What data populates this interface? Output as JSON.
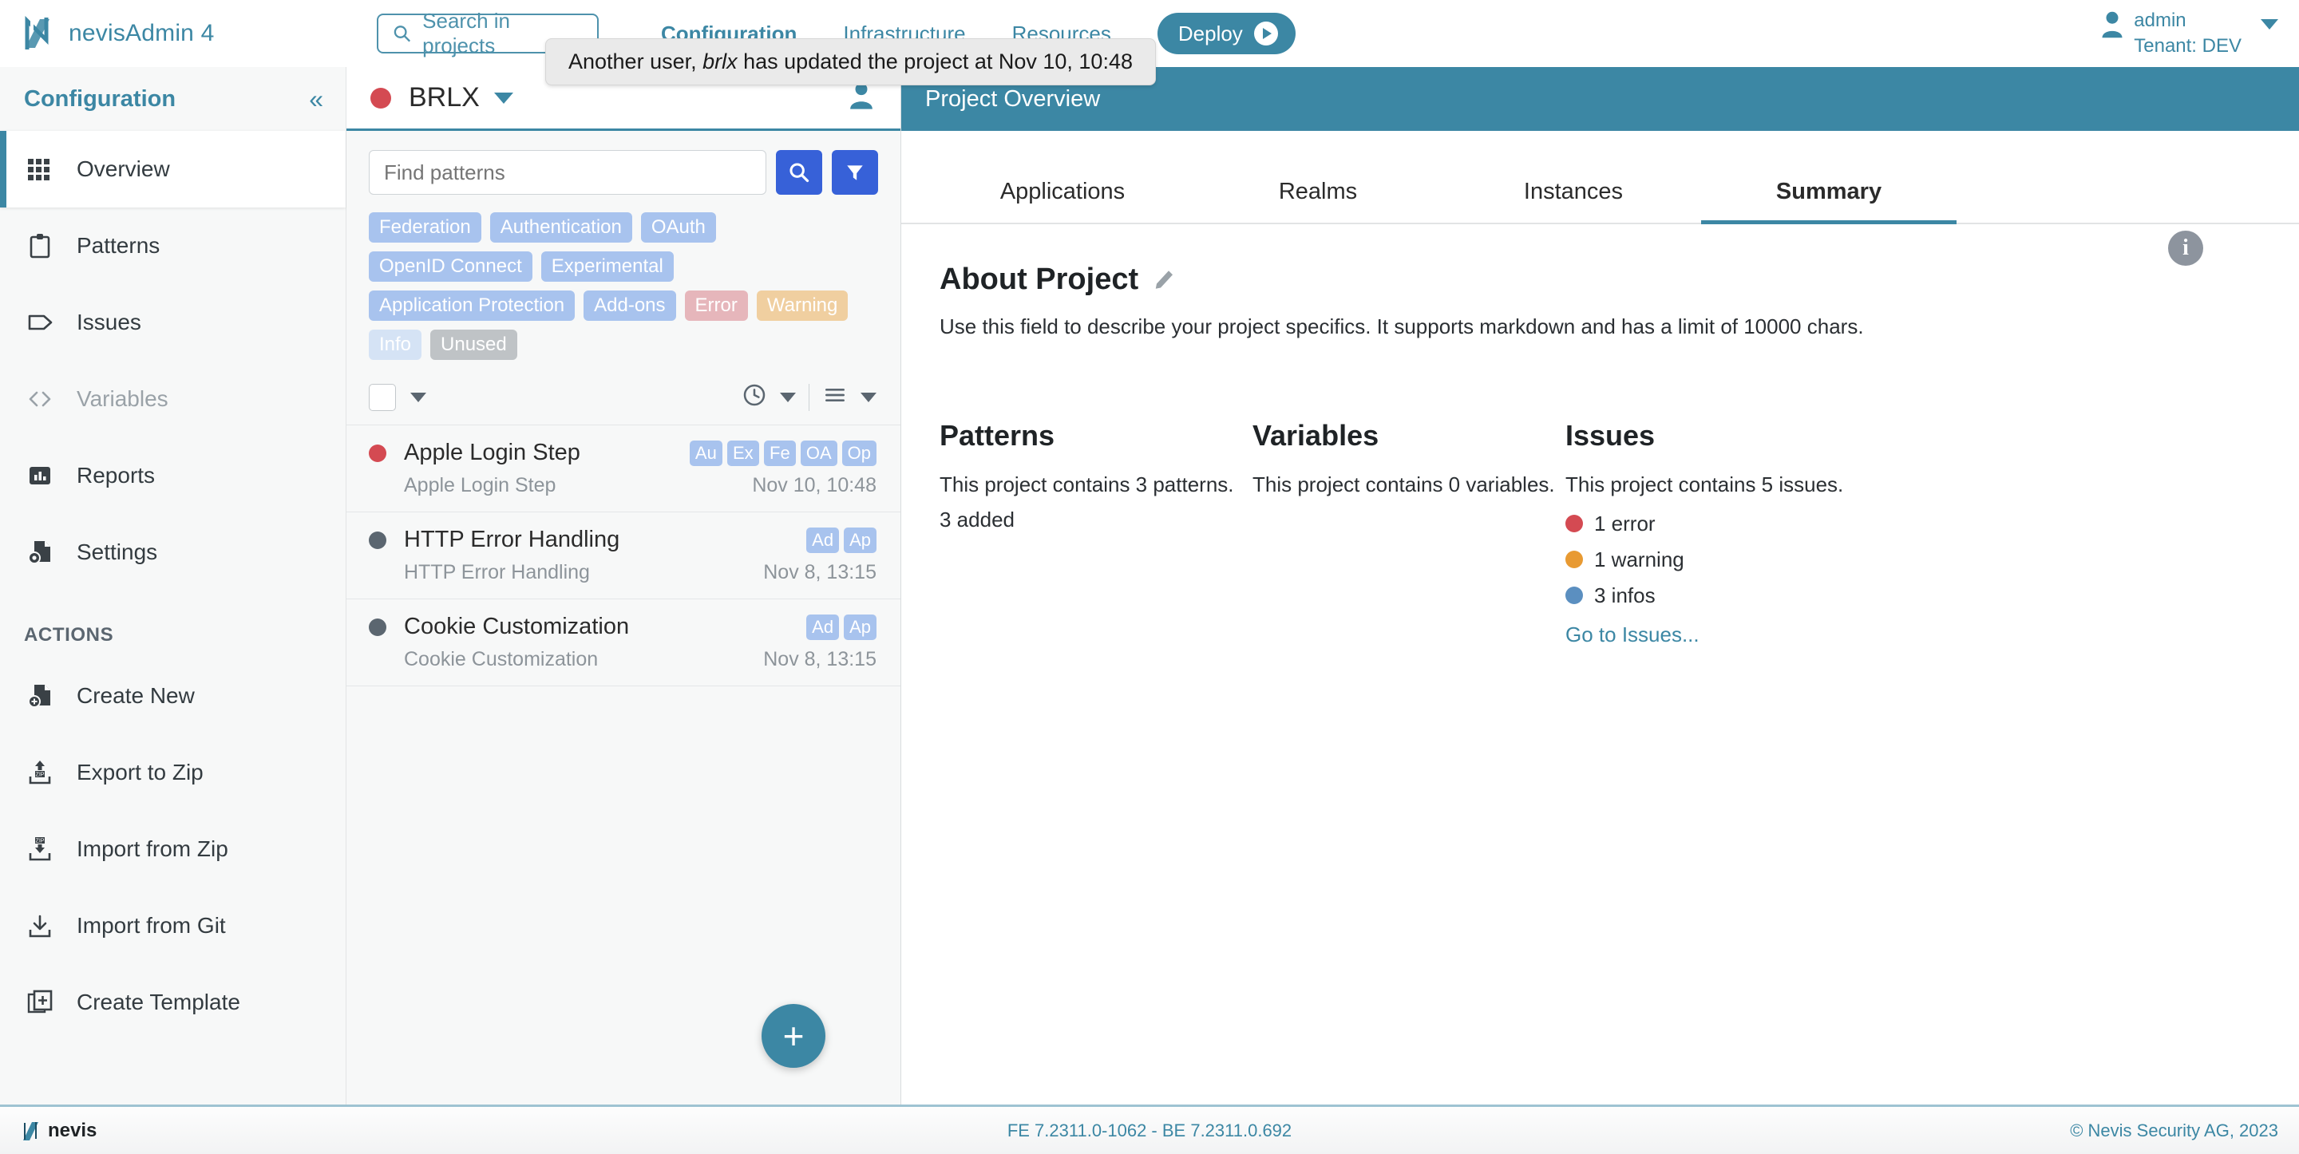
{
  "topbar": {
    "brand": "nevisAdmin 4",
    "search_placeholder": "Search in projects",
    "nav": [
      {
        "label": "Configuration",
        "active": true
      },
      {
        "label": "Infrastructure",
        "active": false
      },
      {
        "label": "Resources",
        "active": false
      }
    ],
    "deploy_label": "Deploy",
    "user": "admin",
    "tenant": "Tenant: DEV"
  },
  "toast": {
    "prefix": "Another user, ",
    "user": "brlx",
    "suffix": " has updated the project at Nov 10, 10:48"
  },
  "sidebar": {
    "title": "Configuration",
    "collapse": "«",
    "items": [
      {
        "label": "Overview",
        "icon": "grid-icon",
        "active": true,
        "disabled": false
      },
      {
        "label": "Patterns",
        "icon": "clipboard-icon",
        "active": false,
        "disabled": false
      },
      {
        "label": "Issues",
        "icon": "tag-icon",
        "active": false,
        "disabled": false
      },
      {
        "label": "Variables",
        "icon": "code-brackets-icon",
        "active": false,
        "disabled": true
      },
      {
        "label": "Reports",
        "icon": "bar-chart-icon",
        "active": false,
        "disabled": false
      },
      {
        "label": "Settings",
        "icon": "file-gear-icon",
        "active": false,
        "disabled": false
      }
    ],
    "actions_label": "ACTIONS",
    "actions": [
      {
        "label": "Create New",
        "icon": "file-plus-icon"
      },
      {
        "label": "Export to Zip",
        "icon": "zip-upload-icon"
      },
      {
        "label": "Import from Zip",
        "icon": "zip-download-icon"
      },
      {
        "label": "Import from Git",
        "icon": "download-icon"
      },
      {
        "label": "Create Template",
        "icon": "copy-plus-icon"
      }
    ]
  },
  "midpanel": {
    "project_name": "BRLX",
    "project_status_color": "#d44a52",
    "search_placeholder": "Find patterns",
    "chips": [
      {
        "label": "Federation",
        "style": "default"
      },
      {
        "label": "Authentication",
        "style": "default"
      },
      {
        "label": "OAuth",
        "style": "default"
      },
      {
        "label": "OpenID Connect",
        "style": "default"
      },
      {
        "label": "Experimental",
        "style": "default"
      },
      {
        "label": "Application Protection",
        "style": "default"
      },
      {
        "label": "Add-ons",
        "style": "default"
      },
      {
        "label": "Error",
        "style": "error"
      },
      {
        "label": "Warning",
        "style": "warning"
      },
      {
        "label": "Info",
        "style": "info"
      },
      {
        "label": "Unused",
        "style": "unused"
      }
    ],
    "patterns": [
      {
        "title": "Apple Login Step",
        "subtitle": "Apple Login Step",
        "date": "Nov 10, 10:48",
        "dot": "red",
        "badges": [
          "Au",
          "Ex",
          "Fe",
          "OA",
          "Op"
        ]
      },
      {
        "title": "HTTP Error Handling",
        "subtitle": "HTTP Error Handling",
        "date": "Nov 8, 13:15",
        "dot": "grey",
        "badges": [
          "Ad",
          "Ap"
        ]
      },
      {
        "title": "Cookie Customization",
        "subtitle": "Cookie Customization",
        "date": "Nov 8, 13:15",
        "dot": "grey",
        "badges": [
          "Ad",
          "Ap"
        ]
      }
    ],
    "fab_label": "+"
  },
  "main": {
    "header": "Project Overview",
    "tabs": [
      {
        "label": "Applications",
        "active": false
      },
      {
        "label": "Realms",
        "active": false
      },
      {
        "label": "Instances",
        "active": false
      },
      {
        "label": "Summary",
        "active": true
      }
    ],
    "about": {
      "title": "About Project",
      "description": "Use this field to describe your project specifics. It supports markdown and has a limit of 10000 chars."
    },
    "columns": {
      "patterns": {
        "title": "Patterns",
        "line1": "This project contains 3 patterns.",
        "line2": "3 added"
      },
      "variables": {
        "title": "Variables",
        "line1": "This project contains 0 variables."
      },
      "issues": {
        "title": "Issues",
        "line1": "This project contains 5 issues.",
        "rows": [
          {
            "label": "1 error",
            "color": "#d44a52"
          },
          {
            "label": "1 warning",
            "color": "#e89a32"
          },
          {
            "label": "3 infos",
            "color": "#5b8fc0"
          }
        ],
        "link": "Go to Issues..."
      }
    }
  },
  "footer": {
    "logo": "nevis",
    "version": "FE 7.2311.0-1062 - BE 7.2311.0.692",
    "copyright": "© Nevis Security AG, 2023"
  }
}
